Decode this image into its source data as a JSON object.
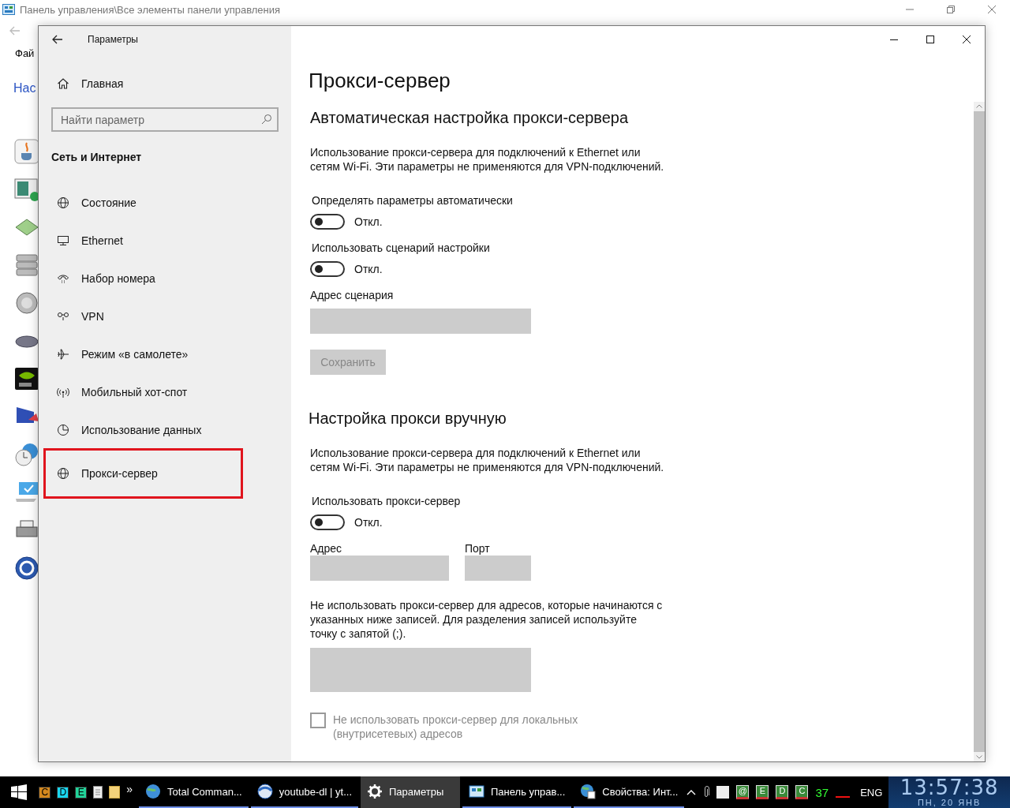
{
  "background_window": {
    "title": "Панель управления\\Все элементы панели управления",
    "menu_item": "Фай",
    "link": "Нас"
  },
  "settings_window": {
    "title": "Параметры",
    "home": "Главная",
    "search": {
      "placeholder": "Найти параметр"
    },
    "section": "Сеть и Интернет",
    "nav": [
      {
        "kind": "globe",
        "label": "Состояние",
        "selected": false
      },
      {
        "kind": "monitor",
        "label": "Ethernet",
        "selected": false
      },
      {
        "kind": "phone",
        "label": "Набор номера",
        "selected": false
      },
      {
        "kind": "vpn",
        "label": "VPN",
        "selected": false
      },
      {
        "kind": "plane",
        "label": "Режим «в самолете»",
        "selected": false
      },
      {
        "kind": "signal",
        "label": "Мобильный хот-спот",
        "selected": false
      },
      {
        "kind": "pie",
        "label": "Использование данных",
        "selected": false
      },
      {
        "kind": "globe",
        "label": "Прокси-сервер",
        "selected": true
      }
    ]
  },
  "page": {
    "title": "Прокси-сервер",
    "auto": {
      "heading": "Автоматическая настройка прокси-сервера",
      "description": "Использование прокси-сервера для подключений к Ethernet или сетям Wi-Fi. Эти параметры не применяются для VPN-подключений.",
      "toggles": [
        {
          "label": "Определять параметры автоматически",
          "on": false,
          "state": "Откл."
        },
        {
          "label": "Использовать сценарий настройки",
          "on": false,
          "state": "Откл."
        }
      ],
      "script_address": {
        "label": "Адрес сценария"
      },
      "save_button": {
        "label": "Сохранить",
        "disabled": true
      }
    },
    "manual": {
      "heading": "Настройка прокси вручную",
      "description": "Использование прокси-сервера для подключений к Ethernet или сетям Wi-Fi. Эти параметры не применяются для VPN-подключений.",
      "toggle": {
        "label": "Использовать прокси-сервер",
        "on": false,
        "state": "Откл."
      },
      "address": {
        "label": "Адрес"
      },
      "port": {
        "label": "Порт"
      },
      "exceptions": {
        "label": "Не использовать прокси-сервер для адресов, которые начинаются с указанных ниже записей. Для разделения записей используйте точку с запятой (;)."
      },
      "local_checkbox": {
        "label": "Не использовать прокси-сервер для локальных (внутрисетевых) адресов",
        "checked": false,
        "disabled": true
      }
    }
  },
  "taskbar": {
    "quick_launch": [
      {
        "label": "C",
        "color": "#d4881e"
      },
      {
        "label": "D",
        "color": "#19d6f0"
      },
      {
        "label": "E",
        "color": "#22d39a"
      }
    ],
    "more": "»",
    "tasks": [
      {
        "kind": "tc",
        "label": "Total Comman...",
        "selected": false
      },
      {
        "kind": "sphere",
        "label": "youtube-dl | yt...",
        "selected": false
      },
      {
        "kind": "gear",
        "label": "Параметры",
        "selected": true
      },
      {
        "kind": "panel",
        "label": "Панель управ...",
        "selected": false
      },
      {
        "kind": "earth",
        "label": "Свойства: Инт...",
        "selected": false
      }
    ],
    "tray_badges": [
      "@",
      "E",
      "D",
      "C"
    ],
    "counter": "37",
    "language": "ENG",
    "time": "13:57:38",
    "date": "ПН, 20 ЯНВ"
  }
}
